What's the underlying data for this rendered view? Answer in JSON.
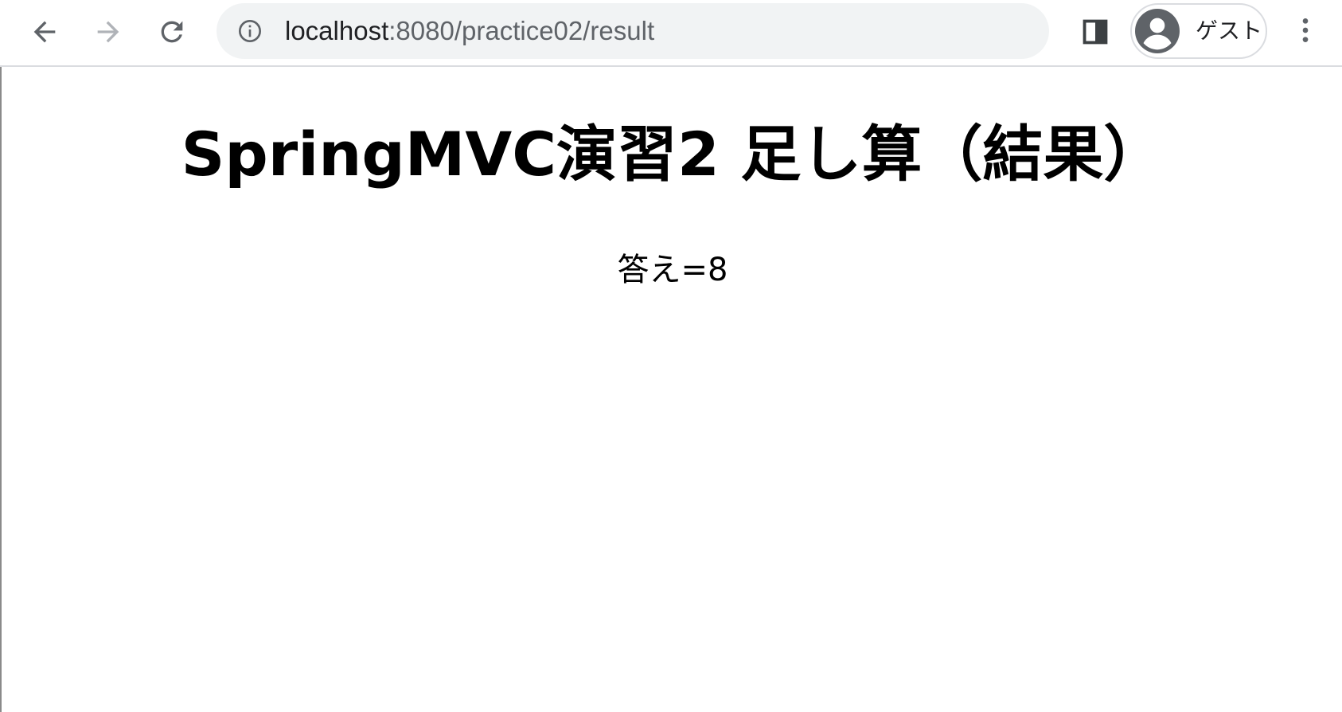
{
  "browser": {
    "url_host": "localhost",
    "url_rest": ":8080/practice02/result",
    "profile_label": "ゲスト",
    "icons": {
      "back": "back-arrow-icon",
      "forward": "forward-arrow-icon",
      "reload": "reload-icon",
      "site_info": "info-icon",
      "side_panel": "side-panel-icon",
      "profile": "profile-avatar-icon",
      "menu": "kebab-menu-icon"
    },
    "forward_enabled": false
  },
  "page": {
    "title": "SpringMVC演習2 足し算（結果）",
    "answer": "答え=8"
  },
  "colors": {
    "icon": "#5f6368",
    "icon_disabled": "#b0b3b8",
    "omnibox_bg": "#f1f3f4",
    "text": "#000000"
  }
}
